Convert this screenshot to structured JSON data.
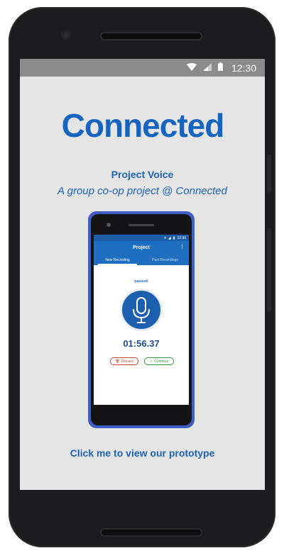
{
  "status_bar": {
    "time": "12:30",
    "icons": [
      "wifi-icon",
      "signal-icon",
      "battery-icon"
    ]
  },
  "logo": {
    "text": "Connected",
    "color": "#1565c0"
  },
  "intro": {
    "title": "Project Voice",
    "subtitle": "A group co-op project @ Connected"
  },
  "preview": {
    "status_time": "12:30",
    "app_title": "Project",
    "tabs": [
      {
        "label": "New Recording",
        "active": true
      },
      {
        "label": "Past Recordings",
        "active": false
      }
    ],
    "state": "paused",
    "timer": "01:56.37",
    "discard_label": "Discard",
    "continue_label": "Continue"
  },
  "cta": {
    "label": "Click me to view our prototype"
  },
  "colors": {
    "brand_blue": "#1b62b8",
    "screen_bg": "#e5e5e6",
    "statusbar_bg": "#8b8b8b",
    "discard": "#b84a2e",
    "continue": "#2f9a3c"
  }
}
